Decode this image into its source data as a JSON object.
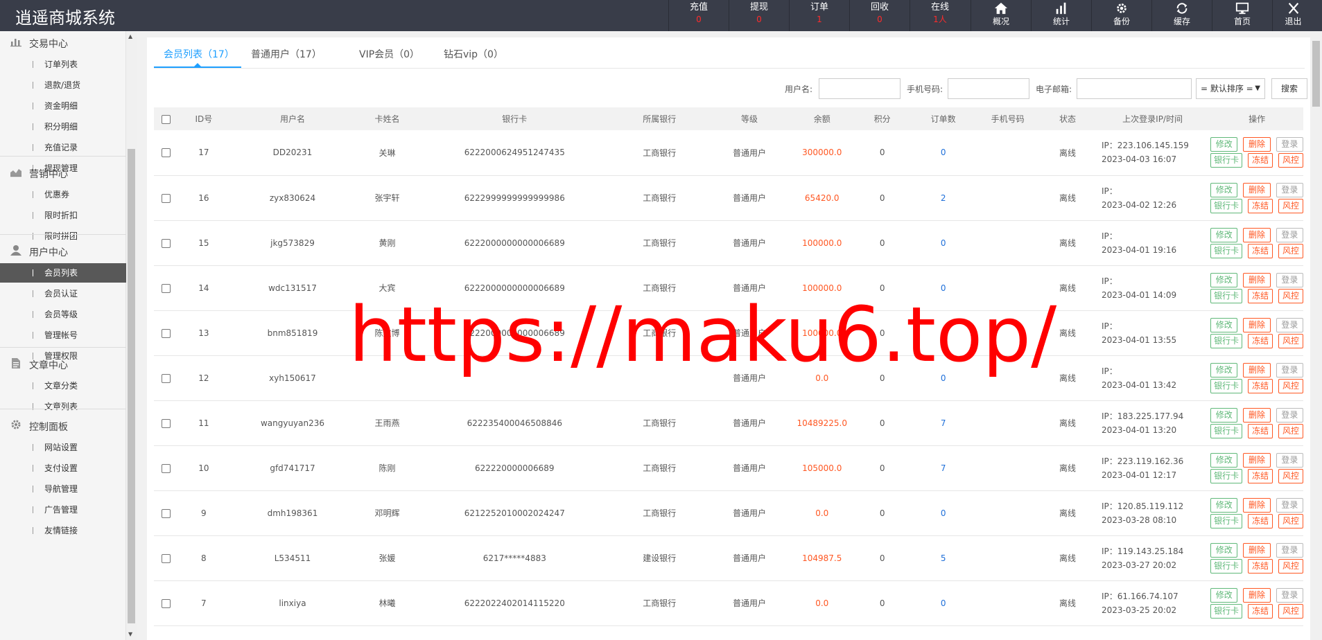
{
  "brand": "逍遥商城系统",
  "top_stats": [
    {
      "label": "充值",
      "value": "0"
    },
    {
      "label": "提现",
      "value": "0"
    },
    {
      "label": "订单",
      "value": "1"
    },
    {
      "label": "回收",
      "value": "0"
    },
    {
      "label": "在线",
      "value": "1人"
    }
  ],
  "top_nav": [
    {
      "label": "概况",
      "icon": "home-icon"
    },
    {
      "label": "统计",
      "icon": "bar-chart-icon"
    },
    {
      "label": "备份",
      "icon": "gear-icon"
    },
    {
      "label": "缓存",
      "icon": "refresh-icon"
    },
    {
      "label": "首页",
      "icon": "monitor-icon"
    },
    {
      "label": "退出",
      "icon": "close-icon"
    }
  ],
  "sidebar": {
    "groups": [
      {
        "title": "交易中心",
        "icon": "chart-icon",
        "items": [
          "订单列表",
          "退款/退货",
          "资金明细",
          "积分明细",
          "充值记录",
          "提现管理"
        ]
      },
      {
        "title": "营销中心",
        "icon": "area-chart-icon",
        "items": [
          "优惠券",
          "限时折扣",
          "限时拼团"
        ]
      },
      {
        "title": "用户中心",
        "icon": "user-icon",
        "items": [
          "会员列表",
          "会员认证",
          "会员等级",
          "管理帐号",
          "管理权限"
        ]
      },
      {
        "title": "文章中心",
        "icon": "document-icon",
        "items": [
          "文章分类",
          "文章列表"
        ]
      },
      {
        "title": "控制面板",
        "icon": "gear-icon",
        "items": [
          "网站设置",
          "支付设置",
          "导航管理",
          "广告管理",
          "友情链接"
        ]
      }
    ],
    "active_item": "会员列表"
  },
  "tabs": [
    "会员列表（17）",
    "普通用户（17）",
    "VIP会员（0）",
    "钻石vip（0）"
  ],
  "search": {
    "username_label": "用户名:",
    "phone_label": "手机号码:",
    "email_label": "电子邮箱:",
    "sort_value": "= 默认排序 =",
    "search_button": "搜索"
  },
  "table": {
    "headers": [
      "ID号",
      "用户名",
      "卡姓名",
      "银行卡",
      "所属银行",
      "等级",
      "余额",
      "积分",
      "订单数",
      "手机号码",
      "状态",
      "上次登录IP/时间",
      "操作"
    ],
    "ops": {
      "edit": "修改",
      "delete": "删除",
      "login": "登录",
      "bank": "银行卡",
      "freeze": "冻结",
      "risk": "风控"
    },
    "rows": [
      {
        "id": "17",
        "username": "DD20231",
        "card_name": "关琳",
        "card": "6222000624951247435",
        "bank": "工商银行",
        "level": "普通用户",
        "balance": "300000.0",
        "points": "0",
        "orders": "0",
        "phone": "",
        "status": "离线",
        "ip": "IP：223.106.145.159",
        "time": "2023-04-03 16:07"
      },
      {
        "id": "16",
        "username": "zyx830624",
        "card_name": "张宇轩",
        "card": "6222999999999999986",
        "bank": "工商银行",
        "level": "普通用户",
        "balance": "65420.0",
        "points": "0",
        "orders": "2",
        "phone": "",
        "status": "离线",
        "ip": "IP：",
        "time": "2023-04-02 12:26"
      },
      {
        "id": "15",
        "username": "jkg573829",
        "card_name": "黄刚",
        "card": "6222000000000006689",
        "bank": "工商银行",
        "level": "普通用户",
        "balance": "100000.0",
        "points": "0",
        "orders": "0",
        "phone": "",
        "status": "离线",
        "ip": "IP：",
        "time": "2023-04-01 19:16"
      },
      {
        "id": "14",
        "username": "wdc131517",
        "card_name": "大宾",
        "card": "6222000000000006689",
        "bank": "工商银行",
        "level": "普通用户",
        "balance": "100000.0",
        "points": "0",
        "orders": "0",
        "phone": "",
        "status": "离线",
        "ip": "IP：",
        "time": "2023-04-01 14:09"
      },
      {
        "id": "13",
        "username": "bnm851819",
        "card_name": "陈文博",
        "card": "6222000000000006689",
        "bank": "工商银行",
        "level": "普通用户",
        "balance": "100000.0",
        "points": "0",
        "orders": "0",
        "phone": "",
        "status": "离线",
        "ip": "IP：",
        "time": "2023-04-01 13:55"
      },
      {
        "id": "12",
        "username": "xyh150617",
        "card_name": "",
        "card": "",
        "bank": "",
        "level": "普通用户",
        "balance": "0.0",
        "points": "0",
        "orders": "0",
        "phone": "",
        "status": "离线",
        "ip": "IP：",
        "time": "2023-04-01 13:42"
      },
      {
        "id": "11",
        "username": "wangyuyan236",
        "card_name": "王雨燕",
        "card": "622235400046508846",
        "bank": "工商银行",
        "level": "普通用户",
        "balance": "10489225.0",
        "points": "0",
        "orders": "7",
        "phone": "",
        "status": "离线",
        "ip": "IP：183.225.177.94",
        "time": "2023-04-01 13:20"
      },
      {
        "id": "10",
        "username": "gfd741717",
        "card_name": "陈刚",
        "card": "622220000006689",
        "bank": "工商银行",
        "level": "普通用户",
        "balance": "105000.0",
        "points": "0",
        "orders": "7",
        "phone": "",
        "status": "离线",
        "ip": "IP：223.119.162.36",
        "time": "2023-04-01 12:17"
      },
      {
        "id": "9",
        "username": "dmh198361",
        "card_name": "邓明辉",
        "card": "6212252010002024247",
        "bank": "工商银行",
        "level": "普通用户",
        "balance": "0.0",
        "points": "0",
        "orders": "0",
        "phone": "",
        "status": "离线",
        "ip": "IP：120.85.119.112",
        "time": "2023-03-28 08:10"
      },
      {
        "id": "8",
        "username": "L534511",
        "card_name": "张媛",
        "card": "6217*****4883",
        "bank": "建设银行",
        "level": "普通用户",
        "balance": "104987.5",
        "points": "0",
        "orders": "5",
        "phone": "",
        "status": "离线",
        "ip": "IP：119.143.25.184",
        "time": "2023-03-27 20:02"
      },
      {
        "id": "7",
        "username": "linxiya",
        "card_name": "林曦",
        "card": "6222022402014115220",
        "bank": "工商银行",
        "level": "普通用户",
        "balance": "0.0",
        "points": "0",
        "orders": "0",
        "phone": "",
        "status": "离线",
        "ip": "IP：61.166.74.107",
        "time": "2023-03-25 20:02"
      }
    ]
  },
  "watermark": "https://maku6.top/"
}
